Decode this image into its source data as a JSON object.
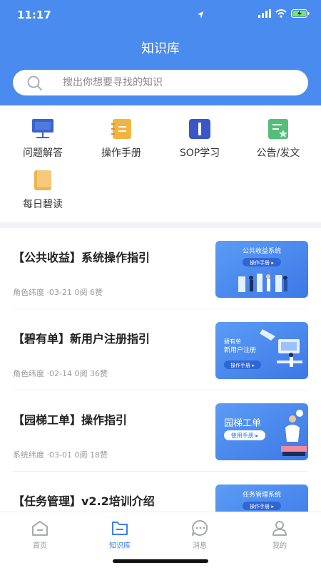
{
  "status": {
    "time": "11:17"
  },
  "header": {
    "title": "知识库"
  },
  "search": {
    "placeholder": "搜出你想要寻找的知识"
  },
  "categories": [
    {
      "label": "问题解答",
      "icon": "monitor-board-icon",
      "color": "#3b63c9"
    },
    {
      "label": "操作手册",
      "icon": "notebook-icon",
      "color": "#f2b440"
    },
    {
      "label": "SOP学习",
      "icon": "book-icon",
      "color": "#3b56c8"
    },
    {
      "label": "公告/发文",
      "icon": "notice-star-icon",
      "color": "#55bd7a"
    },
    {
      "label": "每日碧读",
      "icon": "daily-book-icon",
      "color": "#f0b24e"
    }
  ],
  "articles": [
    {
      "title": "【公共收益】系统操作指引",
      "meta": "角色纬度 ·03-21 0阅 6赞",
      "thumb_title": "公共收益系统",
      "thumb_button": "操作手册 ▸"
    },
    {
      "title": "【碧有单】新用户注册指引",
      "meta": "角色纬度 ·02-14 0阅 36赞",
      "thumb_title": "碧有单\n新用户注册",
      "thumb_title_1": "碧有单",
      "thumb_title_2": "新用户注册",
      "thumb_button": "操作手册 ▸"
    },
    {
      "title": "【园梯工单】操作指引",
      "meta": "系统纬度 ·03-01 0阅 18赞",
      "thumb_title": "园梯工单",
      "thumb_button": "使用手册 ▸"
    },
    {
      "title": "【任务管理】v2.2培训介绍",
      "meta": "",
      "thumb_title": "任务管理系统",
      "thumb_button": "操作手册 ▸"
    }
  ],
  "tabs": [
    {
      "label": "首页",
      "icon": "home-icon",
      "active": false
    },
    {
      "label": "知识库",
      "icon": "folder-icon",
      "active": true
    },
    {
      "label": "消息",
      "icon": "chat-icon",
      "active": false
    },
    {
      "label": "我的",
      "icon": "profile-icon",
      "active": false
    }
  ],
  "colors": {
    "primary": "#4a8bef",
    "active_tab": "#3d7ff0"
  }
}
